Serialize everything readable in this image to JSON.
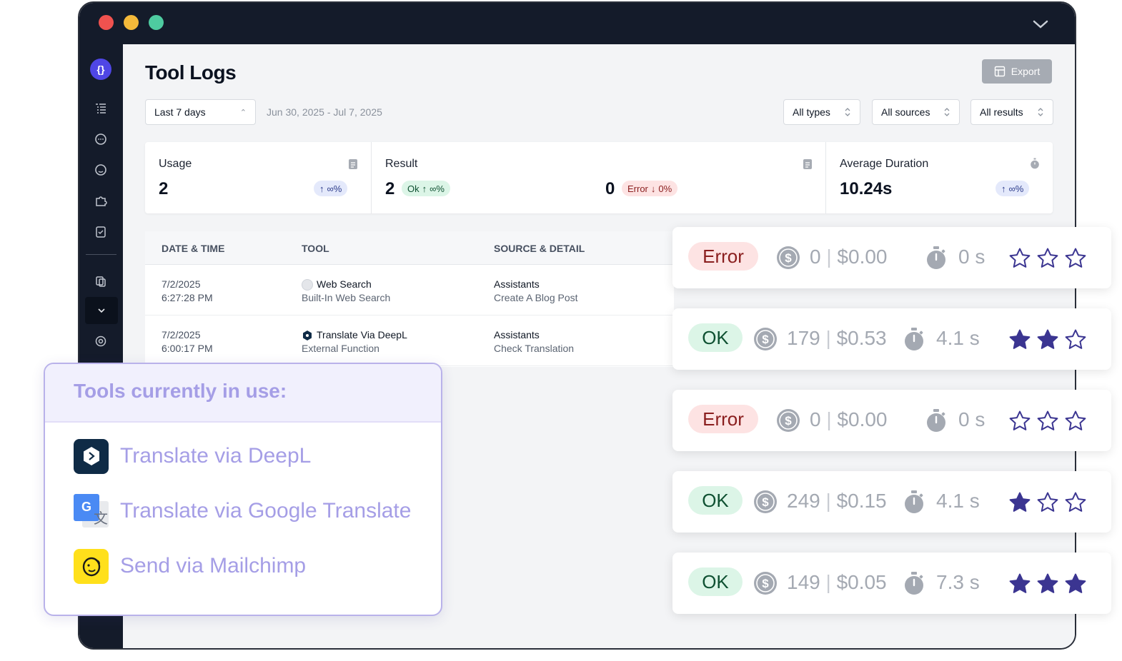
{
  "colors": {
    "titlebar": "#141b2a",
    "accent": "#4f46e5",
    "ok_bg": "#dcf5e7",
    "error_bg": "#fde3e3",
    "star": "#3b3591",
    "tools_text": "#a59ee6"
  },
  "page": {
    "title": "Tool Logs",
    "export_label": "Export"
  },
  "filters": {
    "range": "Last 7 days",
    "dates": "Jun 30, 2025 - Jul 7, 2025",
    "types": "All types",
    "sources": "All sources",
    "results": "All results"
  },
  "stats": {
    "usage": {
      "label": "Usage",
      "value": "2",
      "delta": "∞%"
    },
    "result": {
      "label": "Result",
      "ok_value": "2",
      "ok_label": "Ok",
      "ok_delta": "∞%",
      "err_value": "0",
      "err_label": "Error",
      "err_delta": "0%"
    },
    "duration": {
      "label": "Average Duration",
      "value": "10.24s",
      "delta": "∞%"
    }
  },
  "table": {
    "headers": [
      "DATE & TIME",
      "TOOL",
      "SOURCE & DETAIL"
    ],
    "rows": [
      {
        "date": "7/2/2025",
        "time": "6:27:28 PM",
        "tool": "Web Search",
        "tool_sub": "Built-In Web Search",
        "source": "Assistants",
        "detail": "Create A Blog Post"
      },
      {
        "date": "7/2/2025",
        "time": "6:00:17 PM",
        "tool": "Translate Via DeepL",
        "tool_sub": "External Function",
        "source": "Assistants",
        "detail": "Check Translation"
      }
    ]
  },
  "tools_popup": {
    "title": "Tools currently in use:",
    "items": [
      {
        "label": "Translate via DeepL",
        "icon": "deepl-icon"
      },
      {
        "label": "Translate via Google Translate",
        "icon": "google-translate-icon"
      },
      {
        "label": "Send via Mailchimp",
        "icon": "mailchimp-icon"
      }
    ]
  },
  "result_cards": [
    {
      "status": "Error",
      "tokens": "0",
      "cost": "$0.00",
      "duration": "0 s",
      "stars": 0
    },
    {
      "status": "OK",
      "tokens": "179",
      "cost": "$0.53",
      "duration": "4.1 s",
      "stars": 2
    },
    {
      "status": "Error",
      "tokens": "0",
      "cost": "$0.00",
      "duration": "0 s",
      "stars": 0
    },
    {
      "status": "OK",
      "tokens": "249",
      "cost": "$0.15",
      "duration": "4.1 s",
      "stars": 1
    },
    {
      "status": "OK",
      "tokens": "149",
      "cost": "$0.05",
      "duration": "7.3 s",
      "stars": 3
    }
  ]
}
